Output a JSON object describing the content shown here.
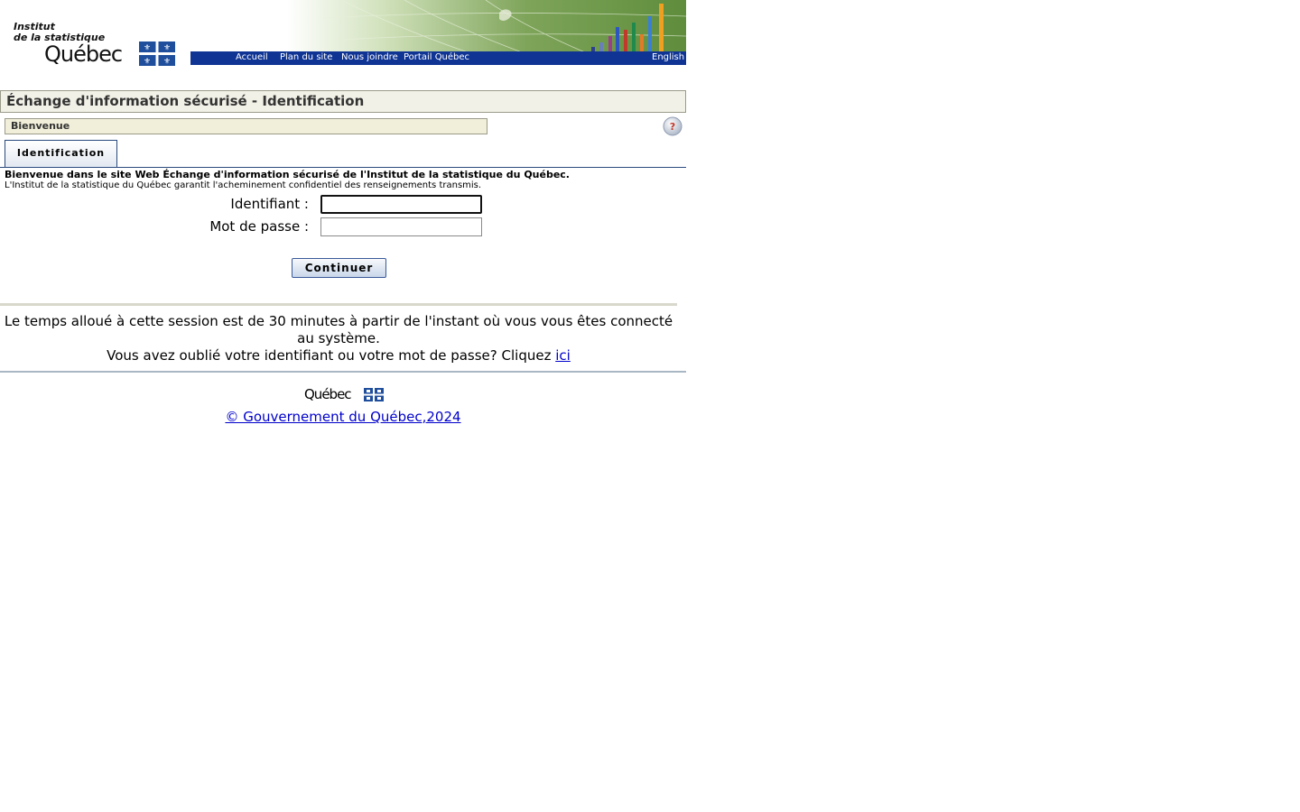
{
  "logo": {
    "line1": "Institut",
    "line2": "de la statistique",
    "line3": "Québec"
  },
  "nav": {
    "items": [
      "Accueil",
      "Plan du site",
      "Nous joindre",
      "Portail Québec"
    ],
    "english": "English"
  },
  "page_title": "Échange d'information sécurisé - Identification",
  "welcome_bar": "Bienvenue",
  "tab_label": "Identification",
  "intro": {
    "line1": "Bienvenue dans le site Web Échange d'information sécurisé de l'Institut de la statistique du Québec.",
    "line2": "L'Institut de la statistique du Québec garantit l'acheminement confidentiel des renseignements transmis."
  },
  "form": {
    "id_label": "Identifiant :",
    "id_value": "",
    "password_label": "Mot de passe :",
    "password_value": "",
    "continue_label": "Continuer"
  },
  "info": {
    "session_text": "Le temps alloué à cette session est de 30 minutes à partir de l'instant où vous vous êtes connecté au système.",
    "forgot_text": "Vous avez oublié votre identifiant ou votre mot de passe? Cliquez",
    "forgot_link": "ici"
  },
  "footer": {
    "quebec": "Québec",
    "copyright": "© Gouvernement du Québec,2024"
  },
  "colors": {
    "nav_blue": "#0f3494",
    "quebec_blue": "#1f4e9c",
    "link": "#0000cc"
  }
}
